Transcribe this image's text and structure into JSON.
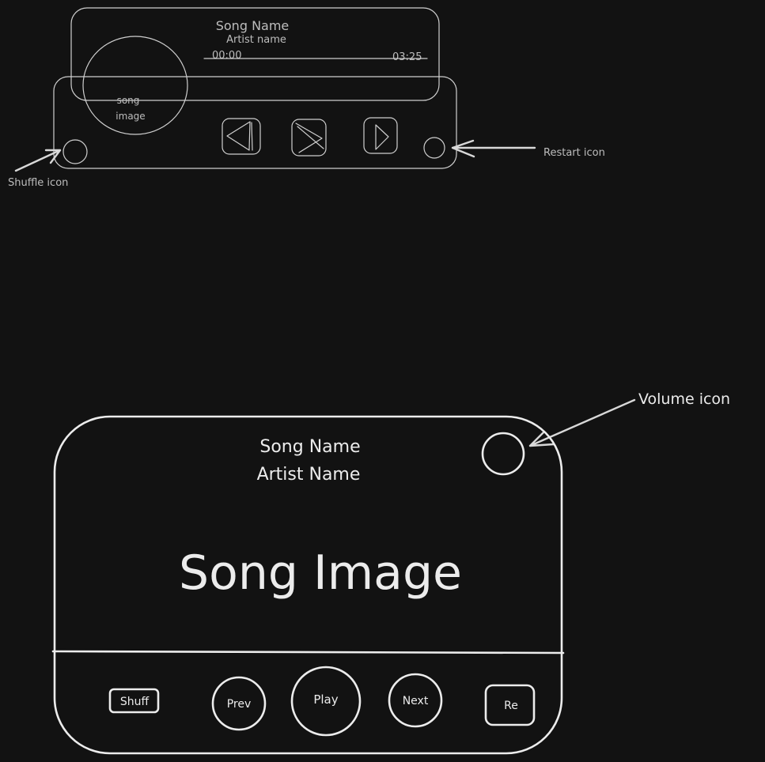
{
  "mini_player": {
    "song_name": "Song Name",
    "artist_name": "Artist name",
    "time_current": "00:00",
    "time_total": "03:25",
    "image_label_line1": "song",
    "image_label_line2": "image",
    "controls": {
      "prev_icon": "triangle-left-icon",
      "play_icon": "chevron-right-icon",
      "next_icon": "triangle-right-icon"
    }
  },
  "annotations": {
    "shuffle": "Shuffle icon",
    "restart": "Restart icon",
    "volume": "Volume icon"
  },
  "full_player": {
    "song_name": "Song Name",
    "artist_name": "Artist Name",
    "image_label": "Song Image",
    "buttons": {
      "shuffle": "Shuff",
      "prev": "Prev",
      "play": "Play",
      "next": "Next",
      "restart": "Re"
    }
  },
  "colors": {
    "background": "#121212",
    "stroke": "#ececec",
    "stroke_dim": "#cfcfcf"
  }
}
